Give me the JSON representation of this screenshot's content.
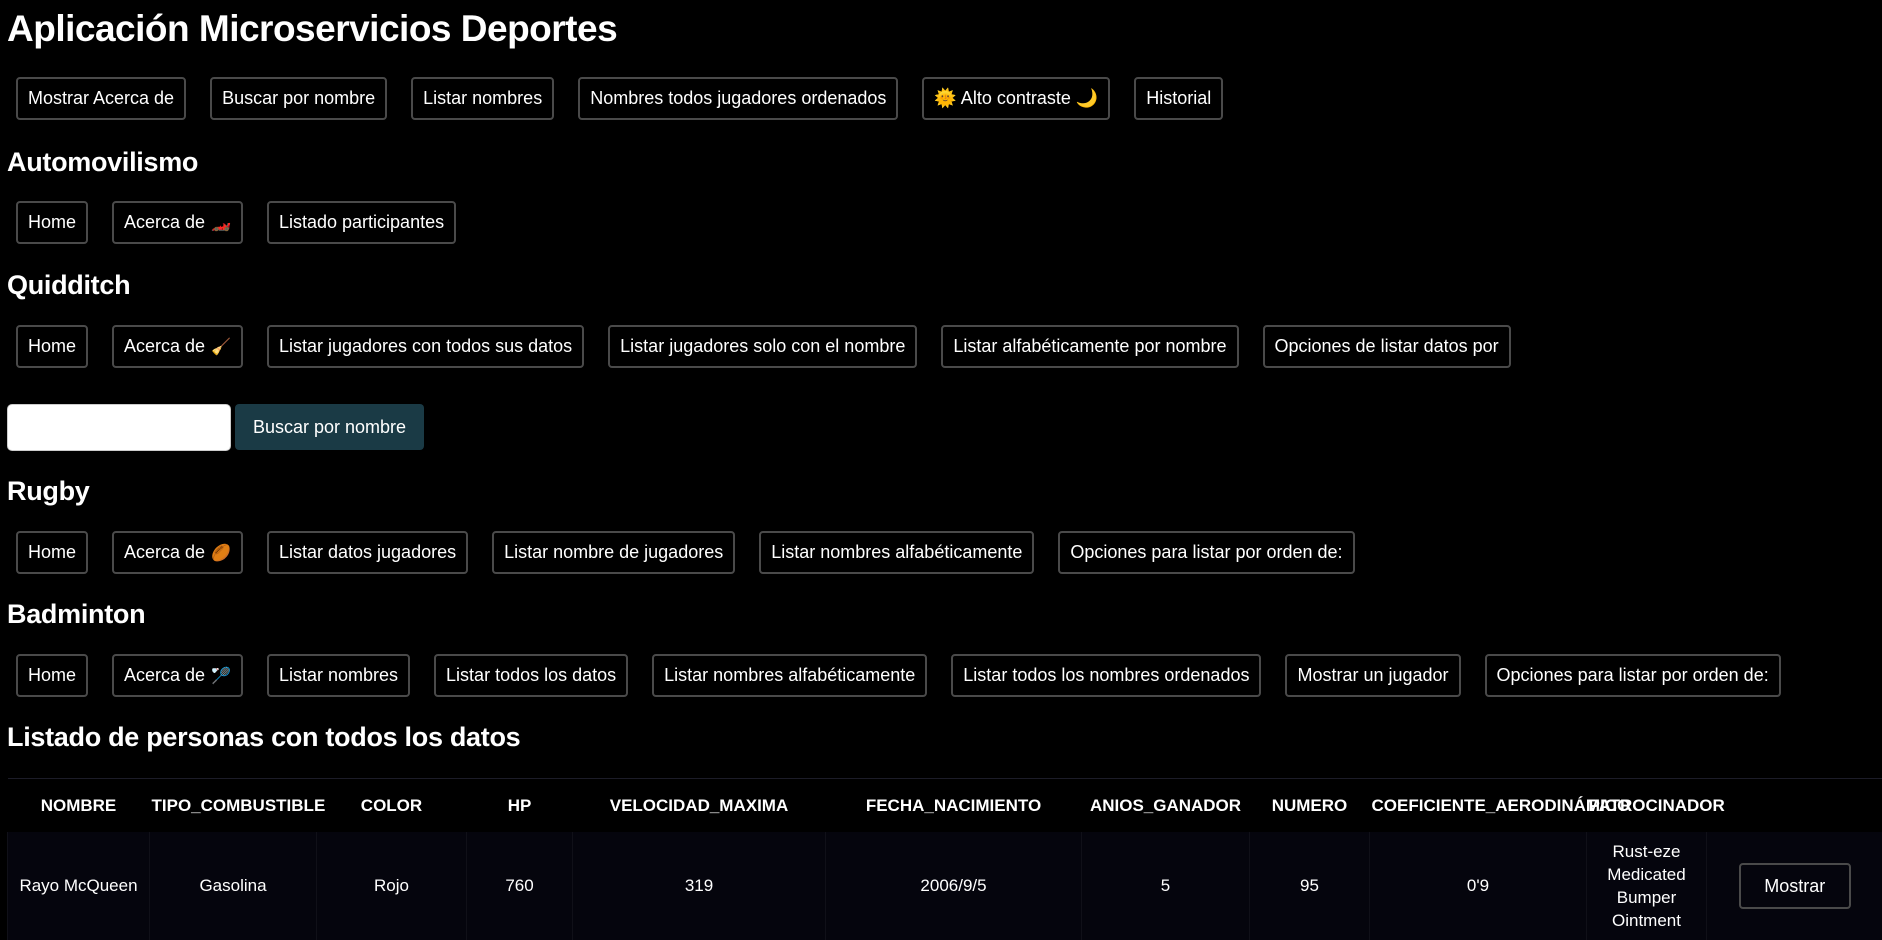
{
  "app": {
    "title": "Aplicación Microservicios Deportes"
  },
  "main_nav": [
    {
      "label": "Mostrar Acerca de"
    },
    {
      "label": "Buscar por nombre"
    },
    {
      "label": "Listar nombres"
    },
    {
      "label": "Nombres todos jugadores ordenados"
    },
    {
      "label": "🌞 Alto contraste 🌙"
    },
    {
      "label": "Historial"
    }
  ],
  "sections": {
    "automovilismo": {
      "title": "Automovilismo",
      "buttons": [
        {
          "label": "Home"
        },
        {
          "label": "Acerca de",
          "emoji": "🏎️"
        },
        {
          "label": "Listado participantes"
        }
      ]
    },
    "quidditch": {
      "title": "Quidditch",
      "buttons": [
        {
          "label": "Home"
        },
        {
          "label": "Acerca de",
          "emoji": "🧹"
        },
        {
          "label": "Listar jugadores con todos sus datos"
        },
        {
          "label": "Listar jugadores solo con el nombre"
        },
        {
          "label": "Listar alfabéticamente por nombre"
        },
        {
          "label": "Opciones de listar datos por"
        }
      ],
      "search": {
        "value": "",
        "button_label": "Buscar por nombre"
      }
    },
    "rugby": {
      "title": "Rugby",
      "buttons": [
        {
          "label": "Home"
        },
        {
          "label": "Acerca de",
          "emoji": "🏉"
        },
        {
          "label": "Listar datos jugadores"
        },
        {
          "label": "Listar nombre de jugadores"
        },
        {
          "label": "Listar nombres alfabéticamente"
        },
        {
          "label": "Opciones para listar por orden de:"
        }
      ]
    },
    "badminton": {
      "title": "Badminton",
      "buttons": [
        {
          "label": "Home"
        },
        {
          "label": "Acerca de",
          "emoji": "🏸"
        },
        {
          "label": "Listar nombres"
        },
        {
          "label": "Listar todos los datos"
        },
        {
          "label": "Listar nombres alfabéticamente"
        },
        {
          "label": "Listar todos los nombres ordenados"
        },
        {
          "label": "Mostrar un jugador"
        },
        {
          "label": "Opciones para listar por orden de:"
        }
      ]
    }
  },
  "listing": {
    "title": "Listado de personas con todos los datos",
    "columns": [
      "NOMBRE",
      "TIPO_COMBUSTIBLE",
      "COLOR",
      "HP",
      "VELOCIDAD_MAXIMA",
      "FECHA_NACIMIENTO",
      "ANIOS_GANADOR",
      "NUMERO",
      "COEFICIENTE_AERODINÁMICO",
      "PATROCINADOR",
      ""
    ],
    "rows": [
      {
        "cells": [
          "Rayo McQueen",
          "Gasolina",
          "Rojo",
          "760",
          "319",
          "2006/9/5",
          "5",
          "95",
          "0'9",
          "Rust-eze Medicated Bumper Ointment"
        ],
        "action_label": "Mostrar"
      }
    ]
  }
}
